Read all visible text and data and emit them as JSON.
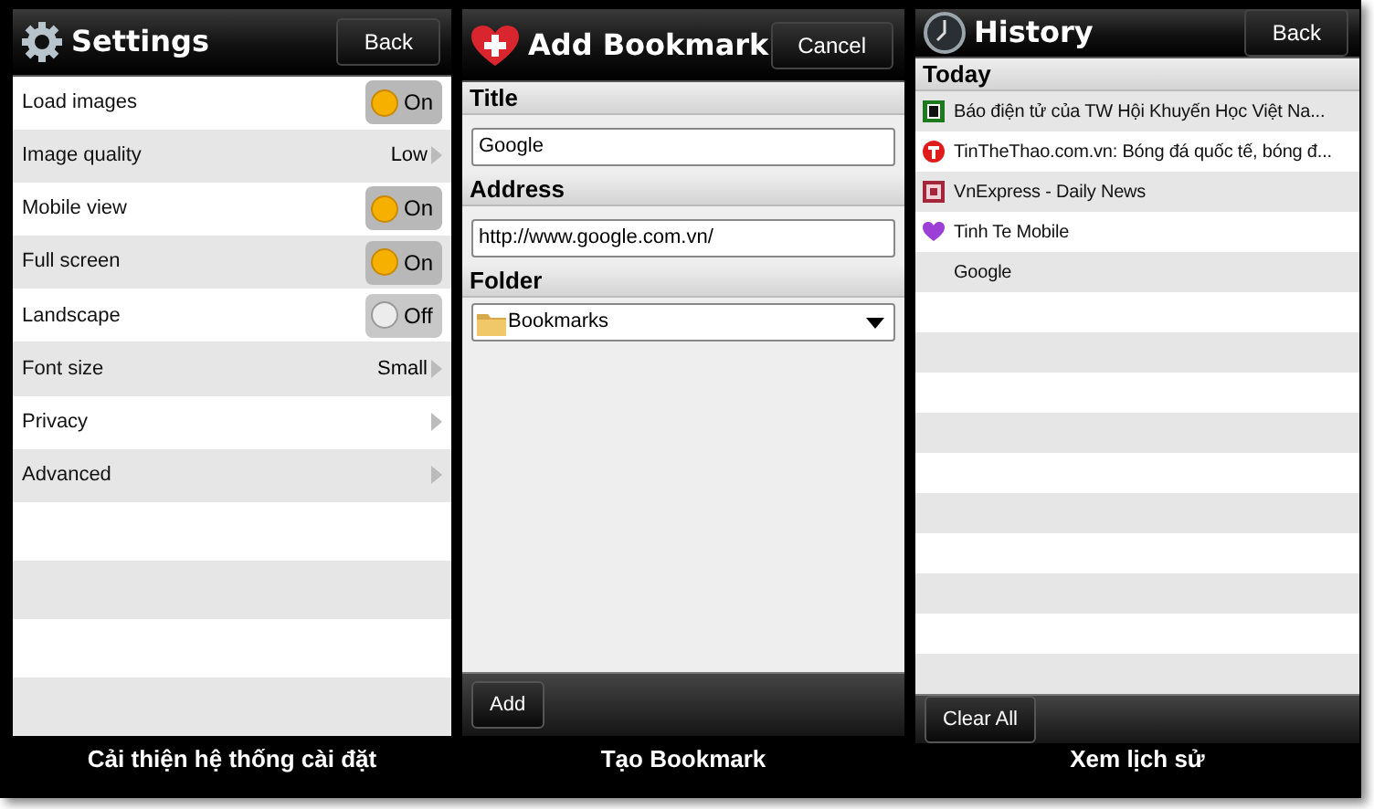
{
  "settings": {
    "title": "Settings",
    "back_button": "Back",
    "caption": "Cải thiện hệ thống cài đặt",
    "rows": [
      {
        "kind": "toggle",
        "label": "Load images",
        "value": "On",
        "on": true
      },
      {
        "kind": "choice",
        "label": "Image quality",
        "value": "Low"
      },
      {
        "kind": "toggle",
        "label": "Mobile view",
        "value": "On",
        "on": true
      },
      {
        "kind": "toggle",
        "label": "Full screen",
        "value": "On",
        "on": true
      },
      {
        "kind": "toggle",
        "label": "Landscape",
        "value": "Off",
        "on": false
      },
      {
        "kind": "choice",
        "label": "Font size",
        "value": "Small"
      },
      {
        "kind": "link",
        "label": "Privacy"
      },
      {
        "kind": "link",
        "label": "Advanced"
      }
    ]
  },
  "add_bookmark": {
    "title": "Add Bookmark",
    "cancel_button": "Cancel",
    "caption": "Tạo Bookmark",
    "title_label": "Title",
    "title_value": "Google",
    "address_label": "Address",
    "address_value": "http://www.google.com.vn/",
    "folder_label": "Folder",
    "folder_value": "Bookmarks",
    "add_button": "Add"
  },
  "history": {
    "title": "History",
    "back_button": "Back",
    "caption": "Xem lịch sử",
    "section": "Today",
    "clear_button": "Clear All",
    "items": [
      {
        "kind": "square-d",
        "title": "Báo điện tử của TW Hội Khuyến Học Việt Na..."
      },
      {
        "kind": "red-t",
        "title": "TinTheThao.com.vn: Bóng đá quốc tế, bóng đ..."
      },
      {
        "kind": "square-e",
        "title": "VnExpress - Daily News"
      },
      {
        "kind": "heart",
        "title": "Tinh Te Mobile"
      },
      {
        "kind": "none",
        "title": "Google"
      }
    ]
  }
}
